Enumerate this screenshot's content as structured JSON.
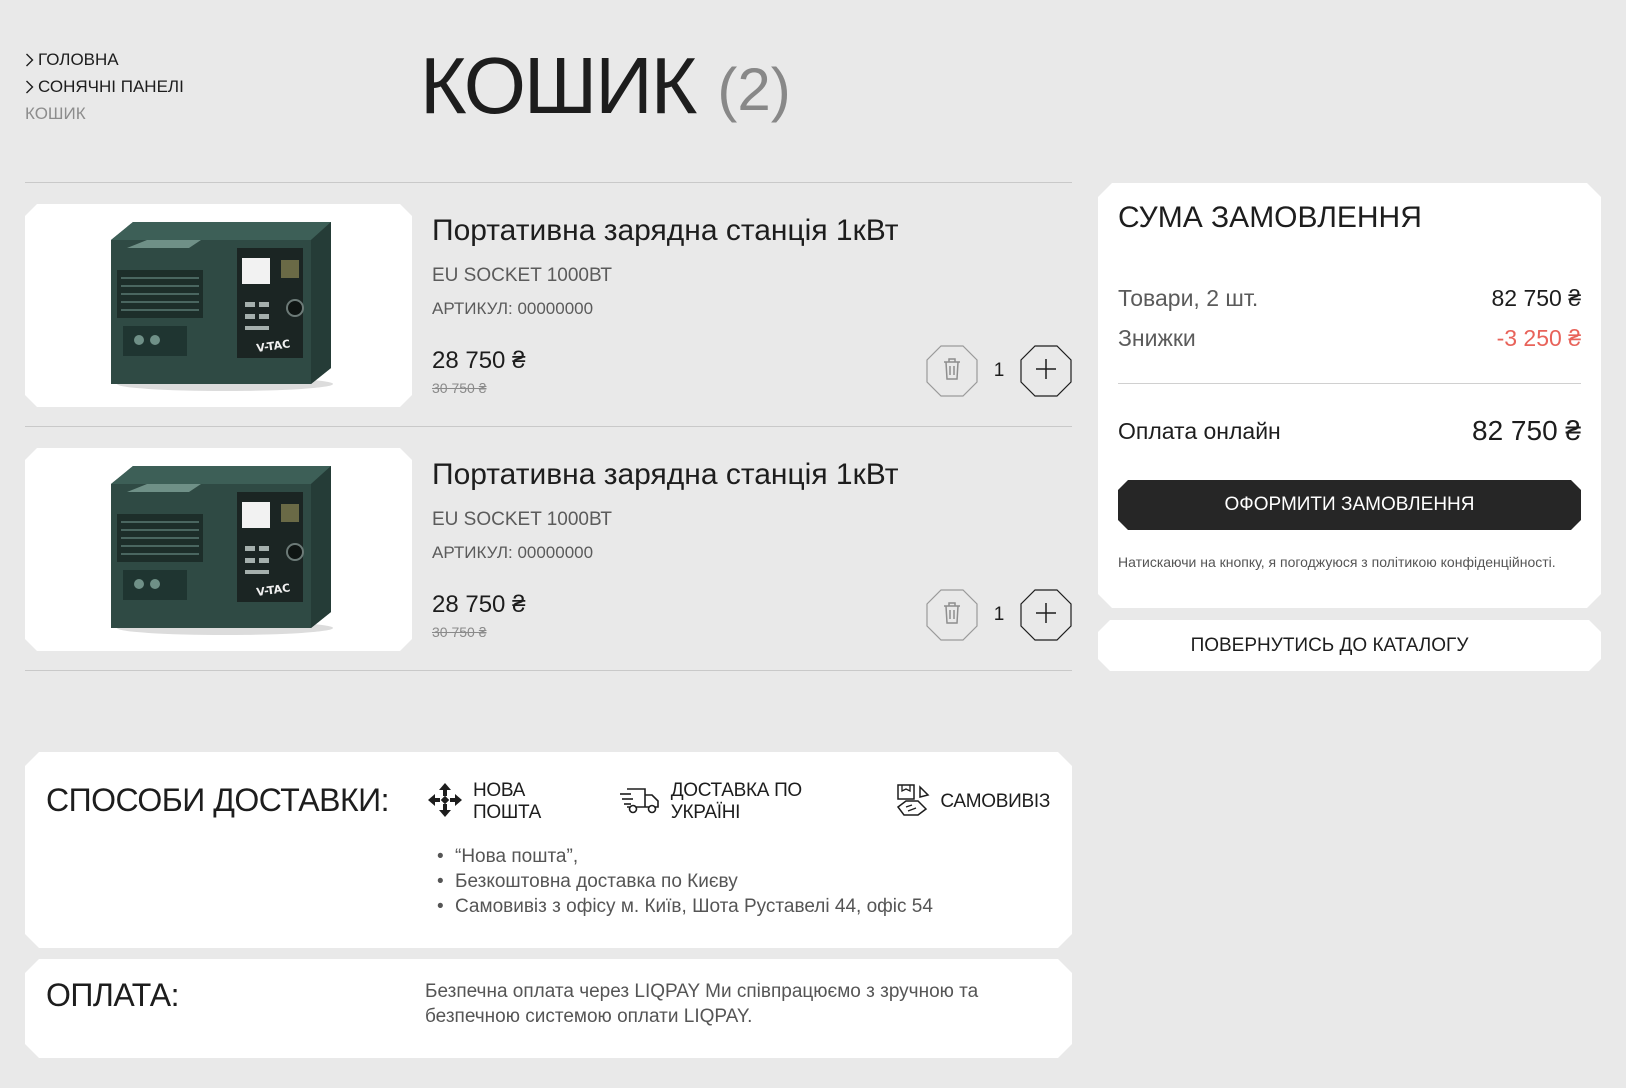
{
  "breadcrumb": {
    "items": [
      "ГОЛОВНА",
      "СОНЯЧНІ ПАНЕЛІ"
    ],
    "current": "КОШИК"
  },
  "page": {
    "title": "КОШИК",
    "count": "(2)"
  },
  "cart": {
    "items": [
      {
        "title": "Портативна зарядна станція 1кВт",
        "variant": "EU SOCKET 1000ВТ",
        "sku": "АРТИКУЛ: 00000000",
        "price": "28 750 ₴",
        "old_price": "30 750 ₴",
        "quantity": "1",
        "brand": "V-TAC"
      },
      {
        "title": "Портативна зарядна станція 1кВт",
        "variant": "EU SOCKET 1000ВТ",
        "sku": "АРТИКУЛ: 00000000",
        "price": "28 750 ₴",
        "old_price": "30 750 ₴",
        "quantity": "1",
        "brand": "V-TAC"
      }
    ],
    "icons": {
      "delete": "trash-icon",
      "increase": "plus-icon"
    }
  },
  "summary": {
    "title": "СУМА ЗАМОВЛЕННЯ",
    "goods_label": "Товари, 2 шт.",
    "goods_value": "82 750 ₴",
    "discount_label": "Знижки",
    "discount_value": "-3 250 ₴",
    "pay_label": "Оплата онлайн",
    "pay_value": "82 750 ₴",
    "checkout_label": "ОФОРМИТИ ЗАМОВЛЕННЯ",
    "agree_note": "Натискаючи на кнопку, я погоджуюся з політикою конфіденційності.",
    "back_label": "ПОВЕРНУТИСЬ ДО КАТАЛОГУ"
  },
  "delivery": {
    "title": "СПОСОБИ ДОСТАВКИ:",
    "methods": [
      {
        "label": "НОВА ПОШТА",
        "icon": "nova-poshta-icon"
      },
      {
        "label": "ДОСТАВКА ПО УКРАЇНІ",
        "icon": "truck-icon"
      },
      {
        "label": "САМОВИВІЗ",
        "icon": "handover-box-icon"
      }
    ],
    "notes": [
      "“Нова пошта”,",
      "Безкоштовна доставка по Києву",
      "Самовивіз з офісу м. Київ, Шота Руставелі 44, офіс 54"
    ]
  },
  "payment": {
    "title": "ОПЛАТА:",
    "text": "Безпечна оплата через LIQPAY Ми співпрацюємо з зручною та безпечною системою оплати LIQPAY."
  },
  "colors": {
    "background": "#e9e9e9",
    "card": "#ffffff",
    "text": "#1d1d1d",
    "muted": "#5b5b5b",
    "discount": "#e8635a",
    "button_dark": "#262626",
    "product_green": "#2f4a44"
  }
}
